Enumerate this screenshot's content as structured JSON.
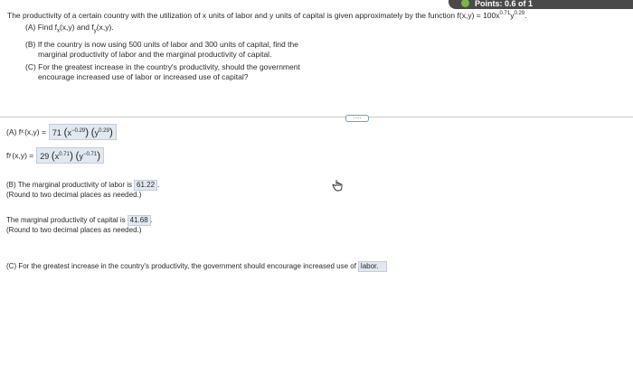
{
  "header": {
    "points_label": "Points: 0.6 of 1"
  },
  "question": {
    "intro_prefix": "The productivity of a certain country with the utilization of x units of labor and y units of capital is given approximately by the function f(x,y) = 100x",
    "intro_exp1": "0.71",
    "intro_mid": "y",
    "intro_exp2": "0.29",
    "intro_suffix": ".",
    "part_a": "(A) Find f",
    "part_a_sub1": "x",
    "part_a_mid": "(x,y) and f",
    "part_a_sub2": "y",
    "part_a_end": "(x,y).",
    "part_b_line1": "(B) If the country is now using 500 units of labor and 300 units of capital, find the",
    "part_b_line2": "marginal productivity of labor and the marginal productivity of capital.",
    "part_c_line1": "(C) For the greatest increase in the country's productivity, should the government",
    "part_c_line2": "encourage increased use of labor or increased use of capital?"
  },
  "answers": {
    "fx_label": "(A) f",
    "fx_sub": "x",
    "fx_args": "(x,y) =",
    "fx_coef": "71",
    "fx_term1_base": "x",
    "fx_term1_exp": "−0.29",
    "fx_term2_base": "y",
    "fx_term2_exp": "0.29",
    "fy_label": "f",
    "fy_sub": "y",
    "fy_args": "(x,y) =",
    "fy_coef": "29",
    "fy_term1_base": "x",
    "fy_term1_exp": "0.71",
    "fy_term2_base": "y",
    "fy_term2_exp": "−0.71",
    "labor_text": "(B) The marginal productivity of labor is",
    "labor_value": "61.22",
    "labor_note": "(Round to two decimal places as needed.)",
    "capital_text": "The marginal productivity of capital is",
    "capital_value": "41.68",
    "capital_note": "(Round to two decimal places as needed.)",
    "c_text": "(C) For the greatest increase in the country's productivity, the government should encourage increased use of",
    "c_value": "labor."
  },
  "more_button": "....."
}
